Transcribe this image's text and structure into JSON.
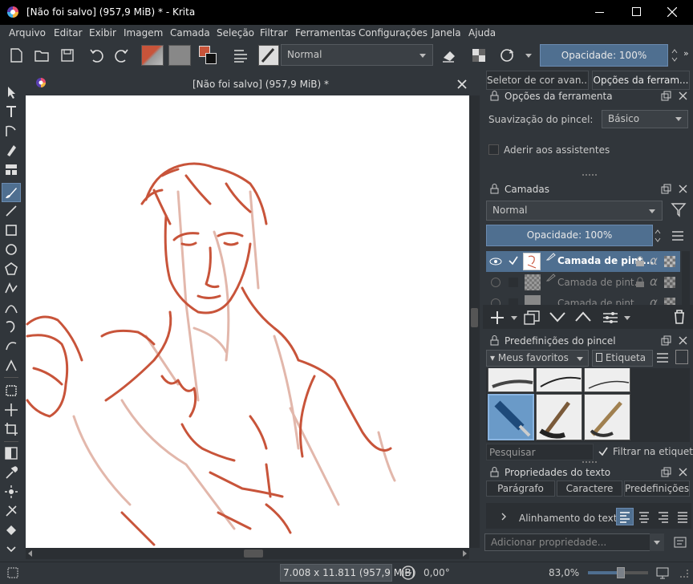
{
  "window": {
    "title": "[Não foi salvo]  (957,9 MiB) * - Krita",
    "controls": [
      "minimize-icon",
      "maximize-icon",
      "close-icon"
    ]
  },
  "menu": [
    "Arquivo",
    "Editar",
    "Exibir",
    "Imagem",
    "Camada",
    "Seleção",
    "Filtrar",
    "Ferramentas",
    "Configurações",
    "Janela",
    "Ajuda"
  ],
  "toolbar": {
    "blend_mode": "Normal",
    "opacity": "Opacidade: 100%",
    "accent_color": "#4f6f90",
    "foreground_color": "#c8543a"
  },
  "document": {
    "title": "[Não foi salvo]  (957,9 MiB) *"
  },
  "right_panel": {
    "tabs": [
      "Seletor de cor avan...",
      "Opções da ferram..."
    ],
    "tool_options": {
      "title": "Opções da ferramenta",
      "smoothing_label": "Suavização do pincel:",
      "smoothing_value": "Básico",
      "assistants_label": "Aderir aos assistentes"
    },
    "layers": {
      "title": "Camadas",
      "blend_mode": "Normal",
      "opacity": "Opacidade: 100%",
      "items": [
        {
          "name": "Camada de pint...",
          "active": true
        },
        {
          "name": "Camada de pint...",
          "active": false
        },
        {
          "name": "Camada de pint...",
          "active": false
        }
      ]
    },
    "brush_presets": {
      "title": "Predefinições do pincel",
      "tag": "Meus favoritos",
      "tag_button": "Etiqueta",
      "search_placeholder": "Pesquisar",
      "filter_label": "Filtrar na etiqueta"
    },
    "text_properties": {
      "title": "Propriedades do texto",
      "tabs": [
        "Parágrafo",
        "Caractere",
        "Predefinições"
      ],
      "alignment_label": "Alinhamento do texto",
      "add_property_placeholder": "Adicionar propriedade..."
    }
  },
  "status": {
    "size": "7.008 x 11.811 (957,9 MiB)",
    "rotation": "0,00°",
    "zoom": "83,0%",
    "zoom_fraction": 0.55
  }
}
